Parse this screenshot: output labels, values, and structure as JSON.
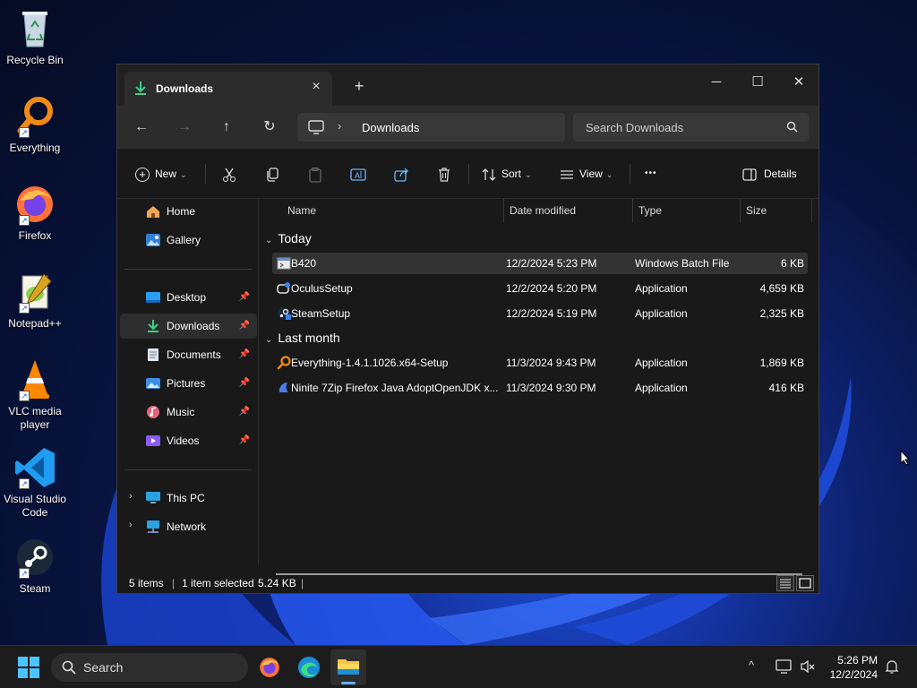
{
  "desktop": {
    "icons": [
      {
        "label": "Recycle Bin",
        "icon": "recycle-bin-icon"
      },
      {
        "label": "Everything",
        "icon": "everything-icon"
      },
      {
        "label": "Firefox",
        "icon": "firefox-icon"
      },
      {
        "label": "Notepad++",
        "icon": "notepadpp-icon"
      },
      {
        "label": "VLC media player",
        "icon": "vlc-icon"
      },
      {
        "label": "Visual Studio Code",
        "icon": "vscode-icon"
      },
      {
        "label": "Steam",
        "icon": "steam-icon"
      }
    ]
  },
  "window": {
    "tab_title": "Downloads",
    "controls": {
      "minimize": "─",
      "maximize": "☐",
      "close": "✕"
    }
  },
  "nav": {
    "back": "←",
    "forward": "→",
    "up": "↑",
    "refresh": "↻",
    "breadcrumb": "Downloads",
    "search_placeholder": "Search Downloads"
  },
  "commands": {
    "new": "New",
    "sort": "Sort",
    "view": "View",
    "more": "•••",
    "details": "Details"
  },
  "sidebar": {
    "items": [
      {
        "label": "Home",
        "icon": "home-icon"
      },
      {
        "label": "Gallery",
        "icon": "gallery-icon"
      },
      {
        "label": "Desktop",
        "icon": "desktop-folder-icon",
        "pinned": true
      },
      {
        "label": "Downloads",
        "icon": "downloads-folder-icon",
        "pinned": true,
        "selected": true
      },
      {
        "label": "Documents",
        "icon": "documents-folder-icon",
        "pinned": true
      },
      {
        "label": "Pictures",
        "icon": "pictures-folder-icon",
        "pinned": true
      },
      {
        "label": "Music",
        "icon": "music-folder-icon",
        "pinned": true
      },
      {
        "label": "Videos",
        "icon": "videos-folder-icon",
        "pinned": true
      },
      {
        "label": "This PC",
        "icon": "this-pc-icon"
      },
      {
        "label": "Network",
        "icon": "network-icon"
      }
    ]
  },
  "columns": {
    "name": "Name",
    "date": "Date modified",
    "type": "Type",
    "size": "Size"
  },
  "groups": [
    {
      "label": "Today",
      "rows": [
        {
          "name": "B420",
          "date": "12/2/2024 5:23 PM",
          "type": "Windows Batch File",
          "size": "6 KB",
          "icon": "batch-file-icon",
          "selected": true
        },
        {
          "name": "OculusSetup",
          "date": "12/2/2024 5:20 PM",
          "type": "Application",
          "size": "4,659 KB",
          "icon": "oculus-setup-icon"
        },
        {
          "name": "SteamSetup",
          "date": "12/2/2024 5:19 PM",
          "type": "Application",
          "size": "2,325 KB",
          "icon": "steam-setup-icon"
        }
      ]
    },
    {
      "label": "Last month",
      "rows": [
        {
          "name": "Everything-1.4.1.1026.x64-Setup",
          "date": "11/3/2024 9:43 PM",
          "type": "Application",
          "size": "1,869 KB",
          "icon": "everything-setup-icon"
        },
        {
          "name": "Ninite 7Zip Firefox Java AdoptOpenJDK x...",
          "date": "11/3/2024 9:30 PM",
          "type": "Application",
          "size": "416 KB",
          "icon": "ninite-icon"
        }
      ]
    }
  ],
  "status": {
    "items": "5 items",
    "selected": "1 item selected",
    "size": "5.24 KB"
  },
  "taskbar": {
    "search_label": "Search",
    "time": "5:26 PM",
    "date": "12/2/2024"
  }
}
